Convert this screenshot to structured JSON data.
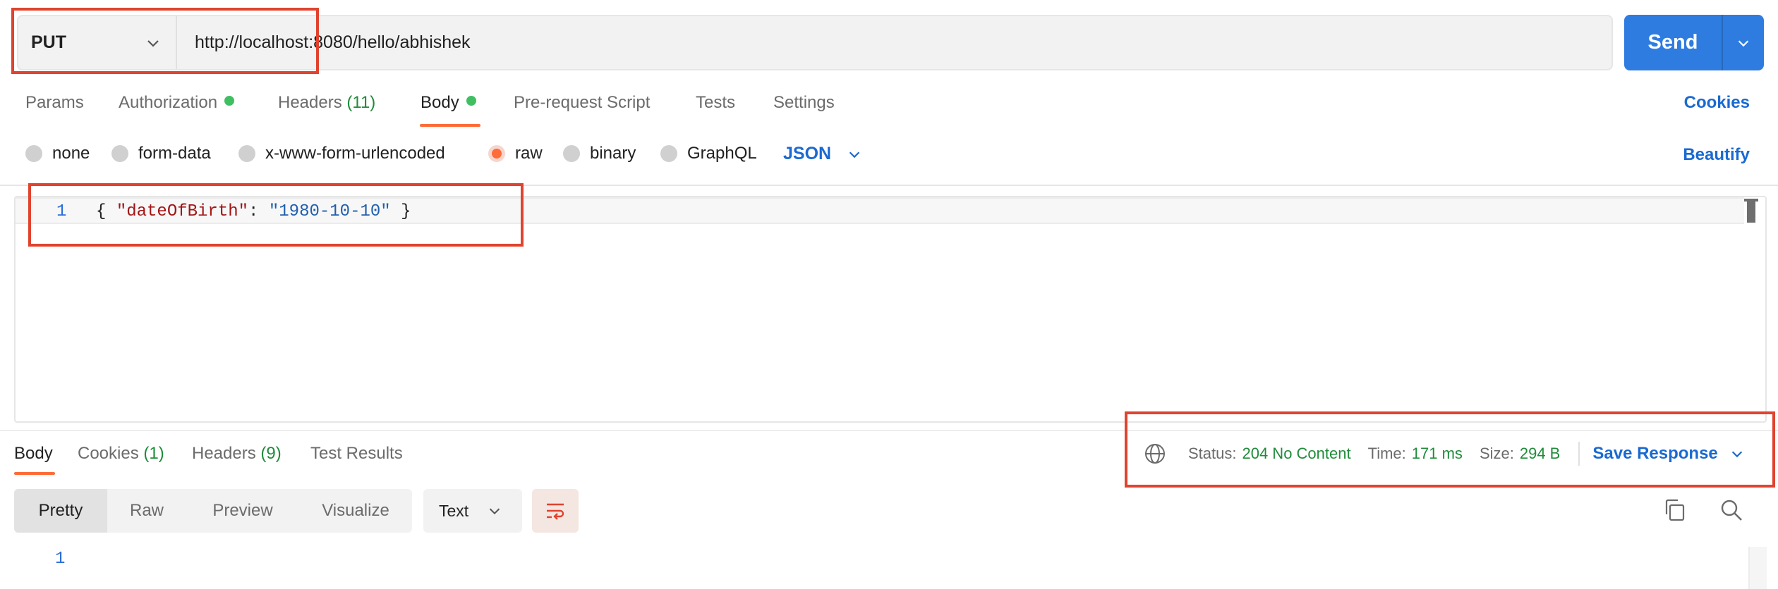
{
  "request": {
    "method": "PUT",
    "url": "http://localhost:8080/hello/abhishek",
    "send_label": "Send"
  },
  "tabs": [
    {
      "label": "Params"
    },
    {
      "label": "Authorization"
    },
    {
      "label": "Headers",
      "count": "(11)"
    },
    {
      "label": "Body"
    },
    {
      "label": "Pre-request Script"
    },
    {
      "label": "Tests"
    },
    {
      "label": "Settings"
    }
  ],
  "cookies_label": "Cookies",
  "body_types": [
    "none",
    "form-data",
    "x-www-form-urlencoded",
    "raw",
    "binary",
    "GraphQL"
  ],
  "selected_body_type": "raw",
  "raw_format": "JSON",
  "beautify_label": "Beautify",
  "editor": {
    "line_number": "1",
    "code": {
      "open": "{ ",
      "key": "\"dateOfBirth\"",
      "colon": ": ",
      "value": "\"1980-10-10\"",
      "close": " }"
    }
  },
  "response": {
    "tabs": [
      {
        "label": "Body"
      },
      {
        "label": "Cookies",
        "count": "(1)"
      },
      {
        "label": "Headers",
        "count": "(9)"
      },
      {
        "label": "Test Results"
      }
    ],
    "status_label": "Status:",
    "status_value": "204 No Content",
    "time_label": "Time:",
    "time_value": "171 ms",
    "size_label": "Size:",
    "size_value": "294 B",
    "save_label": "Save Response",
    "views": [
      "Pretty",
      "Raw",
      "Preview",
      "Visualize"
    ],
    "text_format": "Text",
    "line_number": "1"
  },
  "colors": {
    "accent": "#ff6c37",
    "send": "#2f7ce0",
    "link": "#1a6ad1",
    "success": "#1f8c3a",
    "highlight_box": "#e0432f"
  }
}
